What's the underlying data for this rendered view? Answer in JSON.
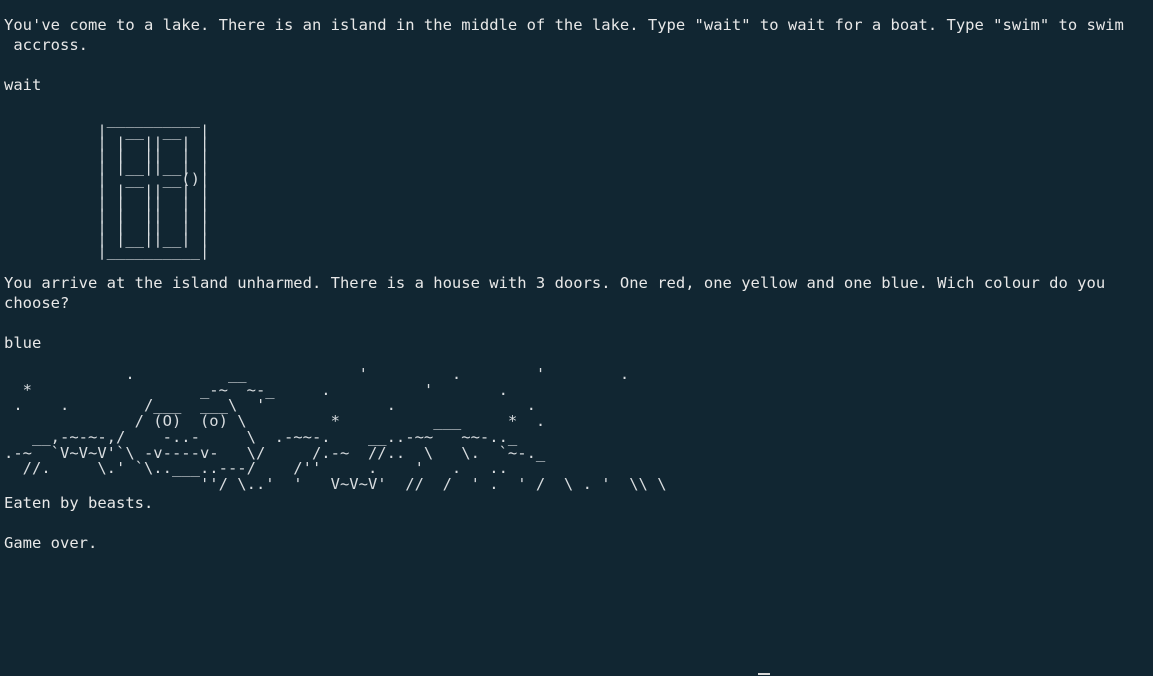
{
  "terminal": {
    "intro_text": "You've come to a lake. There is an island in the middle of the lake. Type \"wait\" to wait for a boat. Type \"swim\" to swim\n accross.",
    "input_1": "wait",
    "door_art": "           __________\n          |  __  __  |\n          | |  ||  | |\n          | |  ||  | |\n          | |__||__| |\n          |  __  __()|\n          | |  ||  | |\n          | |  ||  | |\n          | |  ||  | |\n          | |  ||  | |\n          | |__||__| |\n          |__________|",
    "arrival_text": "You arrive at the island unharmed. There is a house with 3 doors. One red, one yellow and one blue. Wich colour do you choose?",
    "input_2": "blue",
    "beast_art": "             .          __            '         .        '        .\n  *                  _-~  ~-_     .          '       .\n .    .        /___  ___\\  '             .              .\n              / (O)  (o) \\         *          ___     *  .\n   __,-~-~-,/    -..-     \\  .-~~-.    __..-~~   ~~-.._\n.-~  `V~V~V'`\\ -v----v-   \\/     /.-~  //..  \\   \\.  `~-._\n  //.     \\.' `\\..___..---/    /''     .    '   .   ..\n                     ''/ \\..'  '   V~V~V'  //  /  ' .  ' /  \\ . '  \\\\ \\",
    "result_text": "Eaten by beasts.",
    "game_over_text": "Game over."
  }
}
